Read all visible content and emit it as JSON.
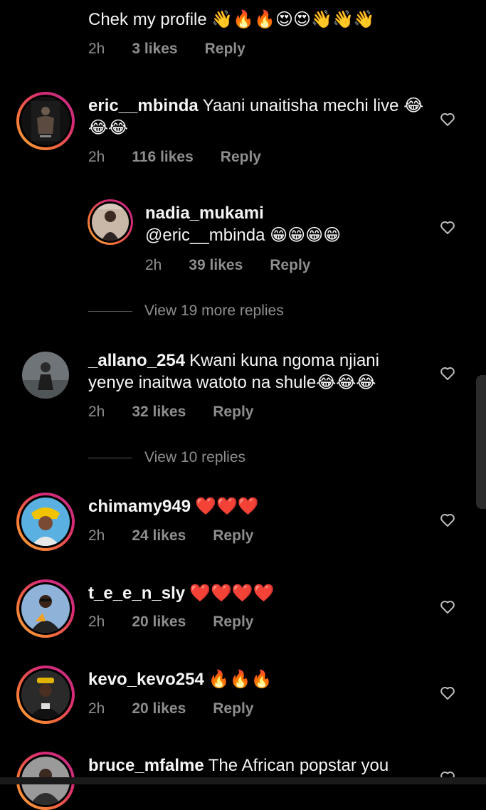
{
  "comments": {
    "c0": {
      "text": "Chek my profile 👋🔥🔥😍😍👋👋👋",
      "time": "2h",
      "likes": "3 likes",
      "reply": "Reply"
    },
    "c1": {
      "user": "eric__mbinda",
      "text": "Yaani unaitisha mechi live 😂😂😂",
      "time": "2h",
      "likes": "116 likes",
      "reply": "Reply"
    },
    "c2": {
      "user": "nadia_mukami",
      "text": "@eric__mbinda 😁😁😁😁",
      "time": "2h",
      "likes": "39 likes",
      "reply": "Reply"
    },
    "view1": "View 19 more replies",
    "c3": {
      "user": "_allano_254",
      "text": "Kwani kuna ngoma njiani yenye inaitwa watoto na shule😂😂😂",
      "time": "2h",
      "likes": "32 likes",
      "reply": "Reply"
    },
    "view2": "View 10 replies",
    "c4": {
      "user": "chimamy949",
      "text": "❤️❤️❤️",
      "time": "2h",
      "likes": "24 likes",
      "reply": "Reply"
    },
    "c5": {
      "user": "t_e_e_n_sly",
      "text": "❤️❤️❤️❤️",
      "time": "2h",
      "likes": "20 likes",
      "reply": "Reply"
    },
    "c6": {
      "user": "kevo_kevo254",
      "text": "🔥🔥🔥",
      "time": "2h",
      "likes": "20 likes",
      "reply": "Reply"
    },
    "c7": {
      "user": "bruce_mfalme",
      "text": "The African popstar you"
    }
  },
  "icons": {
    "like": "heart-outline-icon"
  },
  "colors": {
    "background": "#000000",
    "meta": "#8e8e8e",
    "ring_start": "#f9b13a",
    "ring_end": "#c13584"
  }
}
